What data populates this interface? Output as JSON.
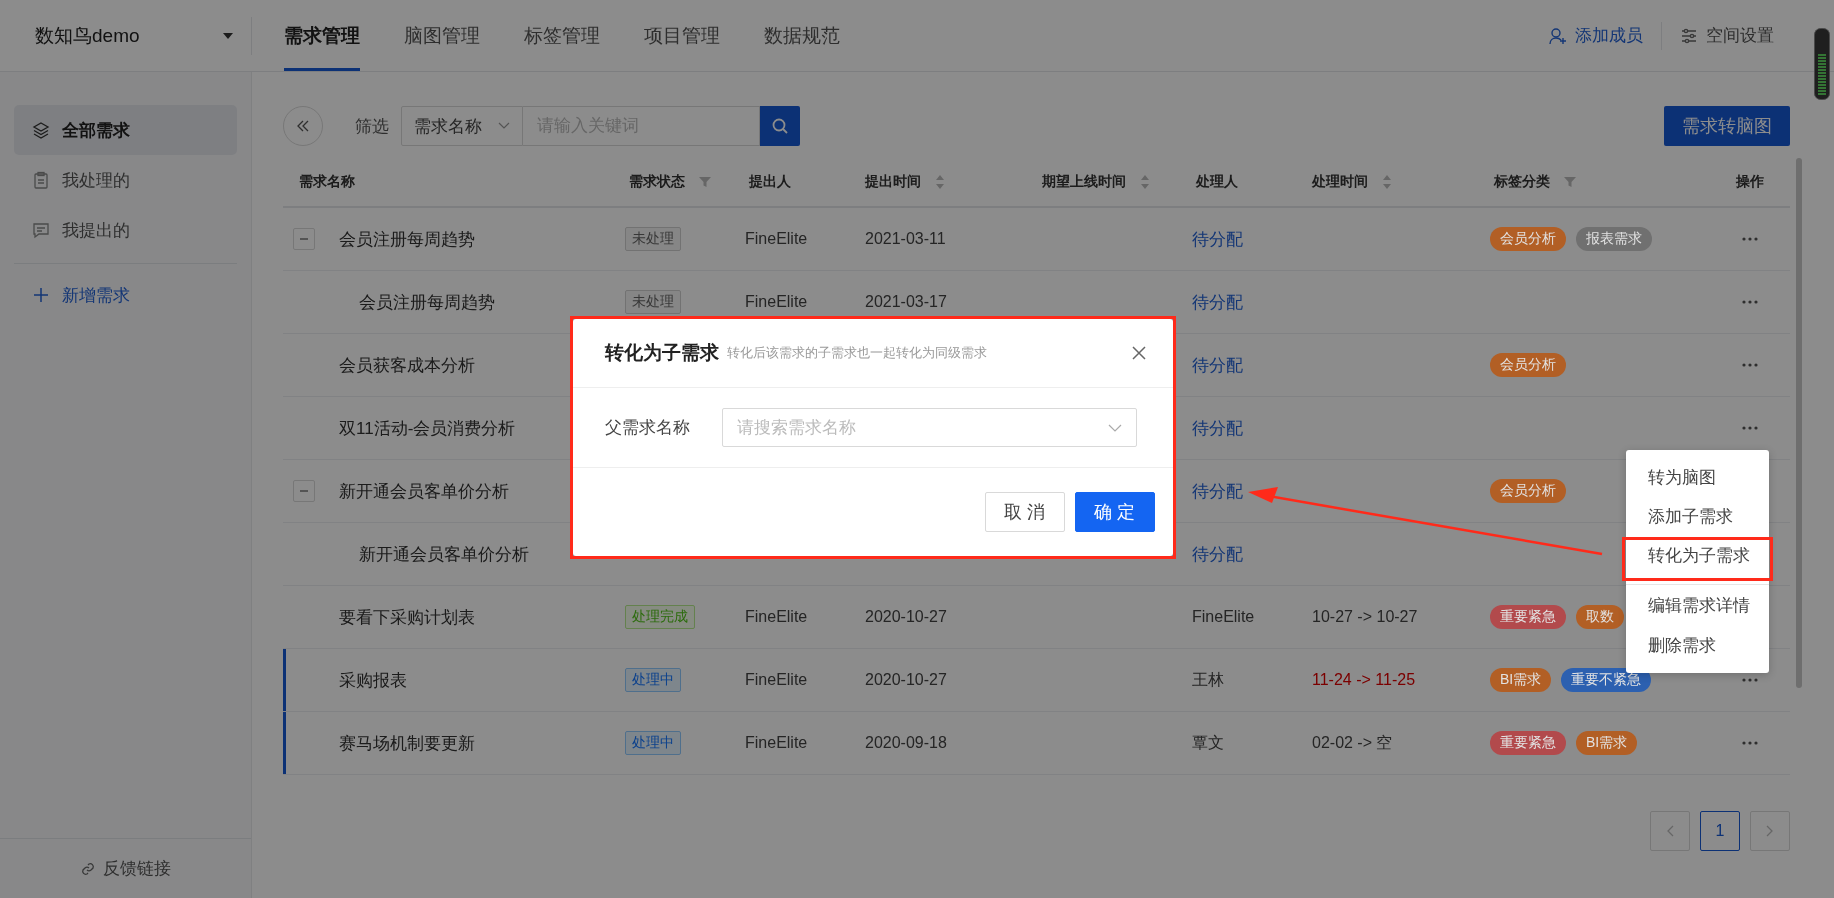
{
  "workspace": {
    "name": "数知鸟demo"
  },
  "nav_tabs": [
    {
      "label": "需求管理",
      "selected": true
    },
    {
      "label": "脑图管理",
      "selected": false
    },
    {
      "label": "标签管理",
      "selected": false
    },
    {
      "label": "项目管理",
      "selected": false
    },
    {
      "label": "数据规范",
      "selected": false
    }
  ],
  "header_actions": [
    {
      "label": "添加成员",
      "kind": "primary"
    },
    {
      "label": "空间设置",
      "kind": "plain"
    }
  ],
  "sidebar": {
    "items": [
      {
        "label": "全部需求",
        "kind": "view",
        "selected": true
      },
      {
        "label": "我处理的",
        "kind": "view",
        "selected": false
      },
      {
        "label": "我提出的",
        "kind": "view",
        "selected": false
      },
      {
        "label": "新增需求",
        "kind": "action",
        "selected": false
      }
    ],
    "footer_link": "反馈链接"
  },
  "toolbar": {
    "filter_label": "筛选",
    "filter_field": "需求名称",
    "search": {
      "placeholder": "请输入关键词"
    },
    "convert_button": "需求转脑图"
  },
  "table": {
    "columns": [
      {
        "label": "需求名称",
        "sortable": false,
        "filterable": false
      },
      {
        "label": "需求状态",
        "sortable": false,
        "filterable": true
      },
      {
        "label": "提出人",
        "sortable": false,
        "filterable": false
      },
      {
        "label": "提出时间",
        "sortable": true,
        "filterable": false
      },
      {
        "label": "期望上线时间",
        "sortable": true,
        "filterable": false
      },
      {
        "label": "处理人",
        "sortable": false,
        "filterable": false
      },
      {
        "label": "处理时间",
        "sortable": true,
        "filterable": false
      },
      {
        "label": "标签分类",
        "sortable": false,
        "filterable": true
      },
      {
        "label": "操作",
        "sortable": false,
        "filterable": false
      }
    ],
    "rows": [
      {
        "name": "会员注册每周趋势",
        "expanded": true,
        "marked": false,
        "status": {
          "label": "未处理",
          "kind": "pending"
        },
        "submitter": "FineElite",
        "date": "2021-03-11",
        "handler": {
          "text": "待分配",
          "assigned": false
        },
        "tags": [
          {
            "label": "会员分析",
            "color": "#b25f25"
          },
          {
            "label": "报表需求",
            "color": "#707070"
          }
        ],
        "children": [
          {
            "name": "会员注册每周趋势",
            "marked": false,
            "status": {
              "label": "未处理",
              "kind": "pending"
            },
            "submitter": "FineElite",
            "date": "2021-03-17",
            "handler": {
              "text": "待分配",
              "assigned": false
            }
          }
        ]
      },
      {
        "name": "会员获客成本分析",
        "marked": false,
        "handler": {
          "text": "待分配",
          "assigned": false
        },
        "tags": [
          {
            "label": "会员分析",
            "color": "#b25f25"
          }
        ]
      },
      {
        "name": "双11活动-会员消费分析",
        "marked": false,
        "handler": {
          "text": "待分配",
          "assigned": false
        }
      },
      {
        "name": "新开通会员客单价分析",
        "expanded": true,
        "marked": false,
        "handler": {
          "text": "待分配",
          "assigned": false
        },
        "tags": [
          {
            "label": "会员分析",
            "color": "#b25f25"
          }
        ],
        "children": [
          {
            "name": "新开通会员客单价分析",
            "marked": false,
            "handler": {
              "text": "待分配",
              "assigned": false
            }
          }
        ]
      },
      {
        "name": "要看下采购计划表",
        "marked": false,
        "status": {
          "label": "处理完成",
          "kind": "done"
        },
        "submitter": "FineElite",
        "date": "2020-10-27",
        "handler": {
          "text": "FineElite",
          "assigned": true
        },
        "time": {
          "text": "10-27 -> 10-27",
          "overdue": false
        },
        "tags": [
          {
            "label": "重要紧急",
            "color": "#b24a4c"
          },
          {
            "label": "取数",
            "color": "#b25f25"
          }
        ]
      },
      {
        "name": "采购报表",
        "marked": true,
        "status": {
          "label": "处理中",
          "kind": "in_progress"
        },
        "submitter": "FineElite",
        "date": "2020-10-27",
        "handler": {
          "text": "王林",
          "assigned": true
        },
        "time": {
          "text": "11-24 -> 11-25",
          "overdue": true
        },
        "tags": [
          {
            "label": "BI需求",
            "color": "#b25f25"
          },
          {
            "label": "重要不紧急",
            "color": "#2c60b0"
          }
        ]
      },
      {
        "name": "赛马场机制要更新",
        "marked": true,
        "status": {
          "label": "处理中",
          "kind": "in_progress"
        },
        "submitter": "FineElite",
        "date": "2020-09-18",
        "handler": {
          "text": "覃文",
          "assigned": true
        },
        "time": {
          "text": "02-02 -> 空",
          "overdue": false
        },
        "tags": [
          {
            "label": "重要紧急",
            "color": "#b24a4c"
          },
          {
            "label": "BI需求",
            "color": "#b25f25"
          }
        ]
      }
    ]
  },
  "pagination": {
    "pages": [
      {
        "label": "1",
        "selected": true
      }
    ]
  },
  "dialog": {
    "title": "转化为子需求",
    "subtitle": "转化后该需求的子需求也一起转化为同级需求",
    "field_label": "父需求名称",
    "field": {
      "placeholder": "请搜索需求名称"
    },
    "buttons": [
      {
        "label": "取 消",
        "kind": "default"
      },
      {
        "label": "确 定",
        "kind": "primary"
      }
    ]
  },
  "context_menu": {
    "items": [
      {
        "label": "转为脑图",
        "divider_before": false
      },
      {
        "label": "添加子需求",
        "divider_before": false
      },
      {
        "label": "转化为子需求",
        "divider_before": false
      },
      {
        "label": "编辑需求详情",
        "divider_before": true
      },
      {
        "label": "删除需求",
        "divider_before": false
      }
    ]
  }
}
